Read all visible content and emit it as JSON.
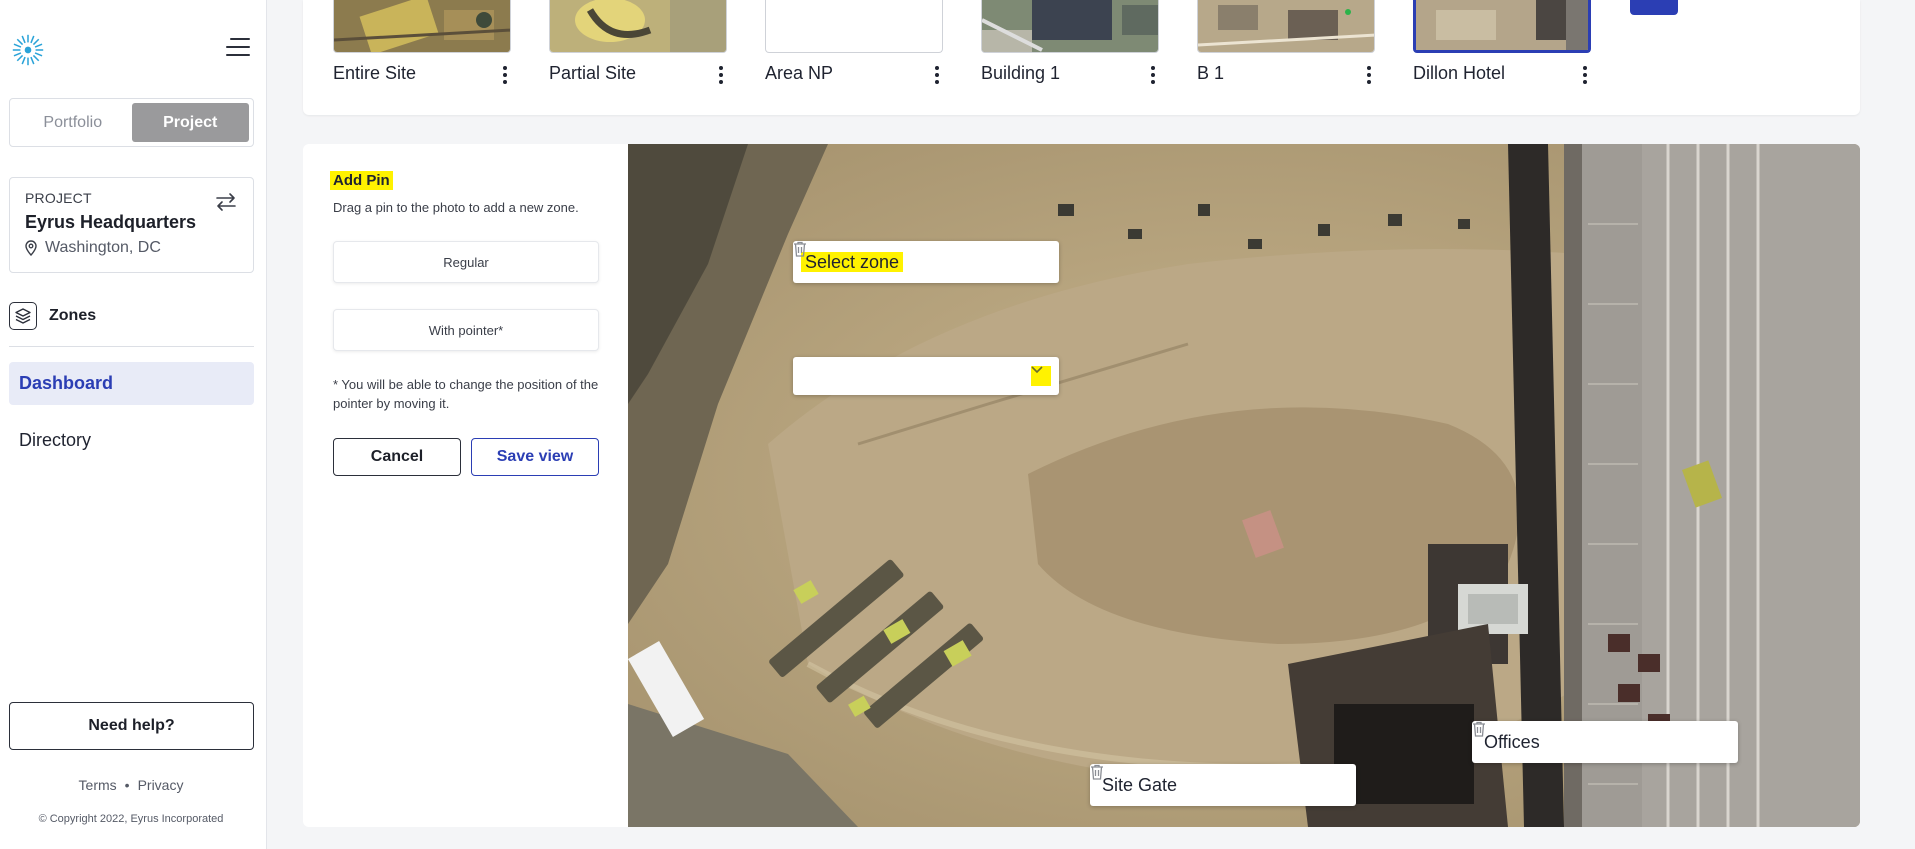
{
  "sidebar": {
    "toggle": {
      "portfolio": "Portfolio",
      "project": "Project"
    },
    "project_card": {
      "label": "PROJECT",
      "name": "Eyrus Headquarters",
      "location": "Washington, DC"
    },
    "zones_label": "Zones",
    "nav": {
      "dashboard": "Dashboard",
      "directory": "Directory"
    },
    "help_button": "Need help?",
    "footer": {
      "terms": "Terms",
      "dot": "•",
      "privacy": "Privacy"
    },
    "copyright": "© Copyright 2022, Eyrus Incorporated"
  },
  "views": [
    {
      "name": "Entire Site"
    },
    {
      "name": "Partial Site"
    },
    {
      "name": "Area NP"
    },
    {
      "name": "Building 1"
    },
    {
      "name": "B 1"
    },
    {
      "name": "Dillon Hotel"
    }
  ],
  "add_pin": {
    "title": "Add Pin",
    "description": "Drag a pin to the photo to add a new zone.",
    "regular_button": "Regular",
    "pointer_button": "With pointer*",
    "note": "* You will be able to change the position of the pointer by moving it.",
    "cancel": "Cancel",
    "save": "Save view"
  },
  "map": {
    "select_zone": "Select zone",
    "zone_input_value": "",
    "labels": {
      "site_gate": "Site Gate",
      "offices": "Offices"
    }
  },
  "colors": {
    "accent": "#2b3eb4",
    "highlight": "#fff200",
    "toggle_active": "#9a9a9c"
  }
}
